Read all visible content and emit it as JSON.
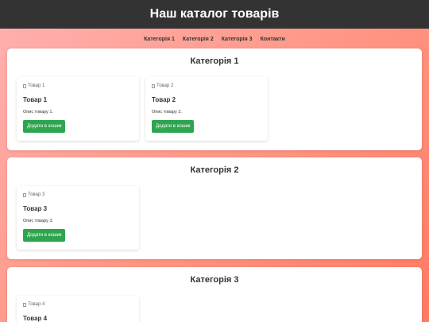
{
  "header": {
    "title": "Наш каталог товарів"
  },
  "nav": {
    "items": [
      {
        "label": "Категорія 1"
      },
      {
        "label": "Категорія 2"
      },
      {
        "label": "Категорія 3"
      },
      {
        "label": "Контакти"
      }
    ]
  },
  "sections": [
    {
      "title": "Категорія 1",
      "products": [
        {
          "image_alt": "Товар 1",
          "name": "Товар 1",
          "description": "Опис товару 1.",
          "button": "Додати в кошик"
        },
        {
          "image_alt": "Товар 2",
          "name": "Товар 2",
          "description": "Опис товару 2.",
          "button": "Додати в кошик"
        }
      ]
    },
    {
      "title": "Категорія 2",
      "products": [
        {
          "image_alt": "Товар 3",
          "name": "Товар 3",
          "description": "Опис товару 3.",
          "button": "Додати в кошик"
        }
      ]
    },
    {
      "title": "Категорія 3",
      "products": [
        {
          "image_alt": "Товар 4",
          "name": "Товар 4"
        }
      ]
    }
  ],
  "colors": {
    "header_bg": "#333333",
    "button_bg": "#2ea44f",
    "background_start": "#ffb1b1",
    "background_end": "#ff7a62"
  }
}
